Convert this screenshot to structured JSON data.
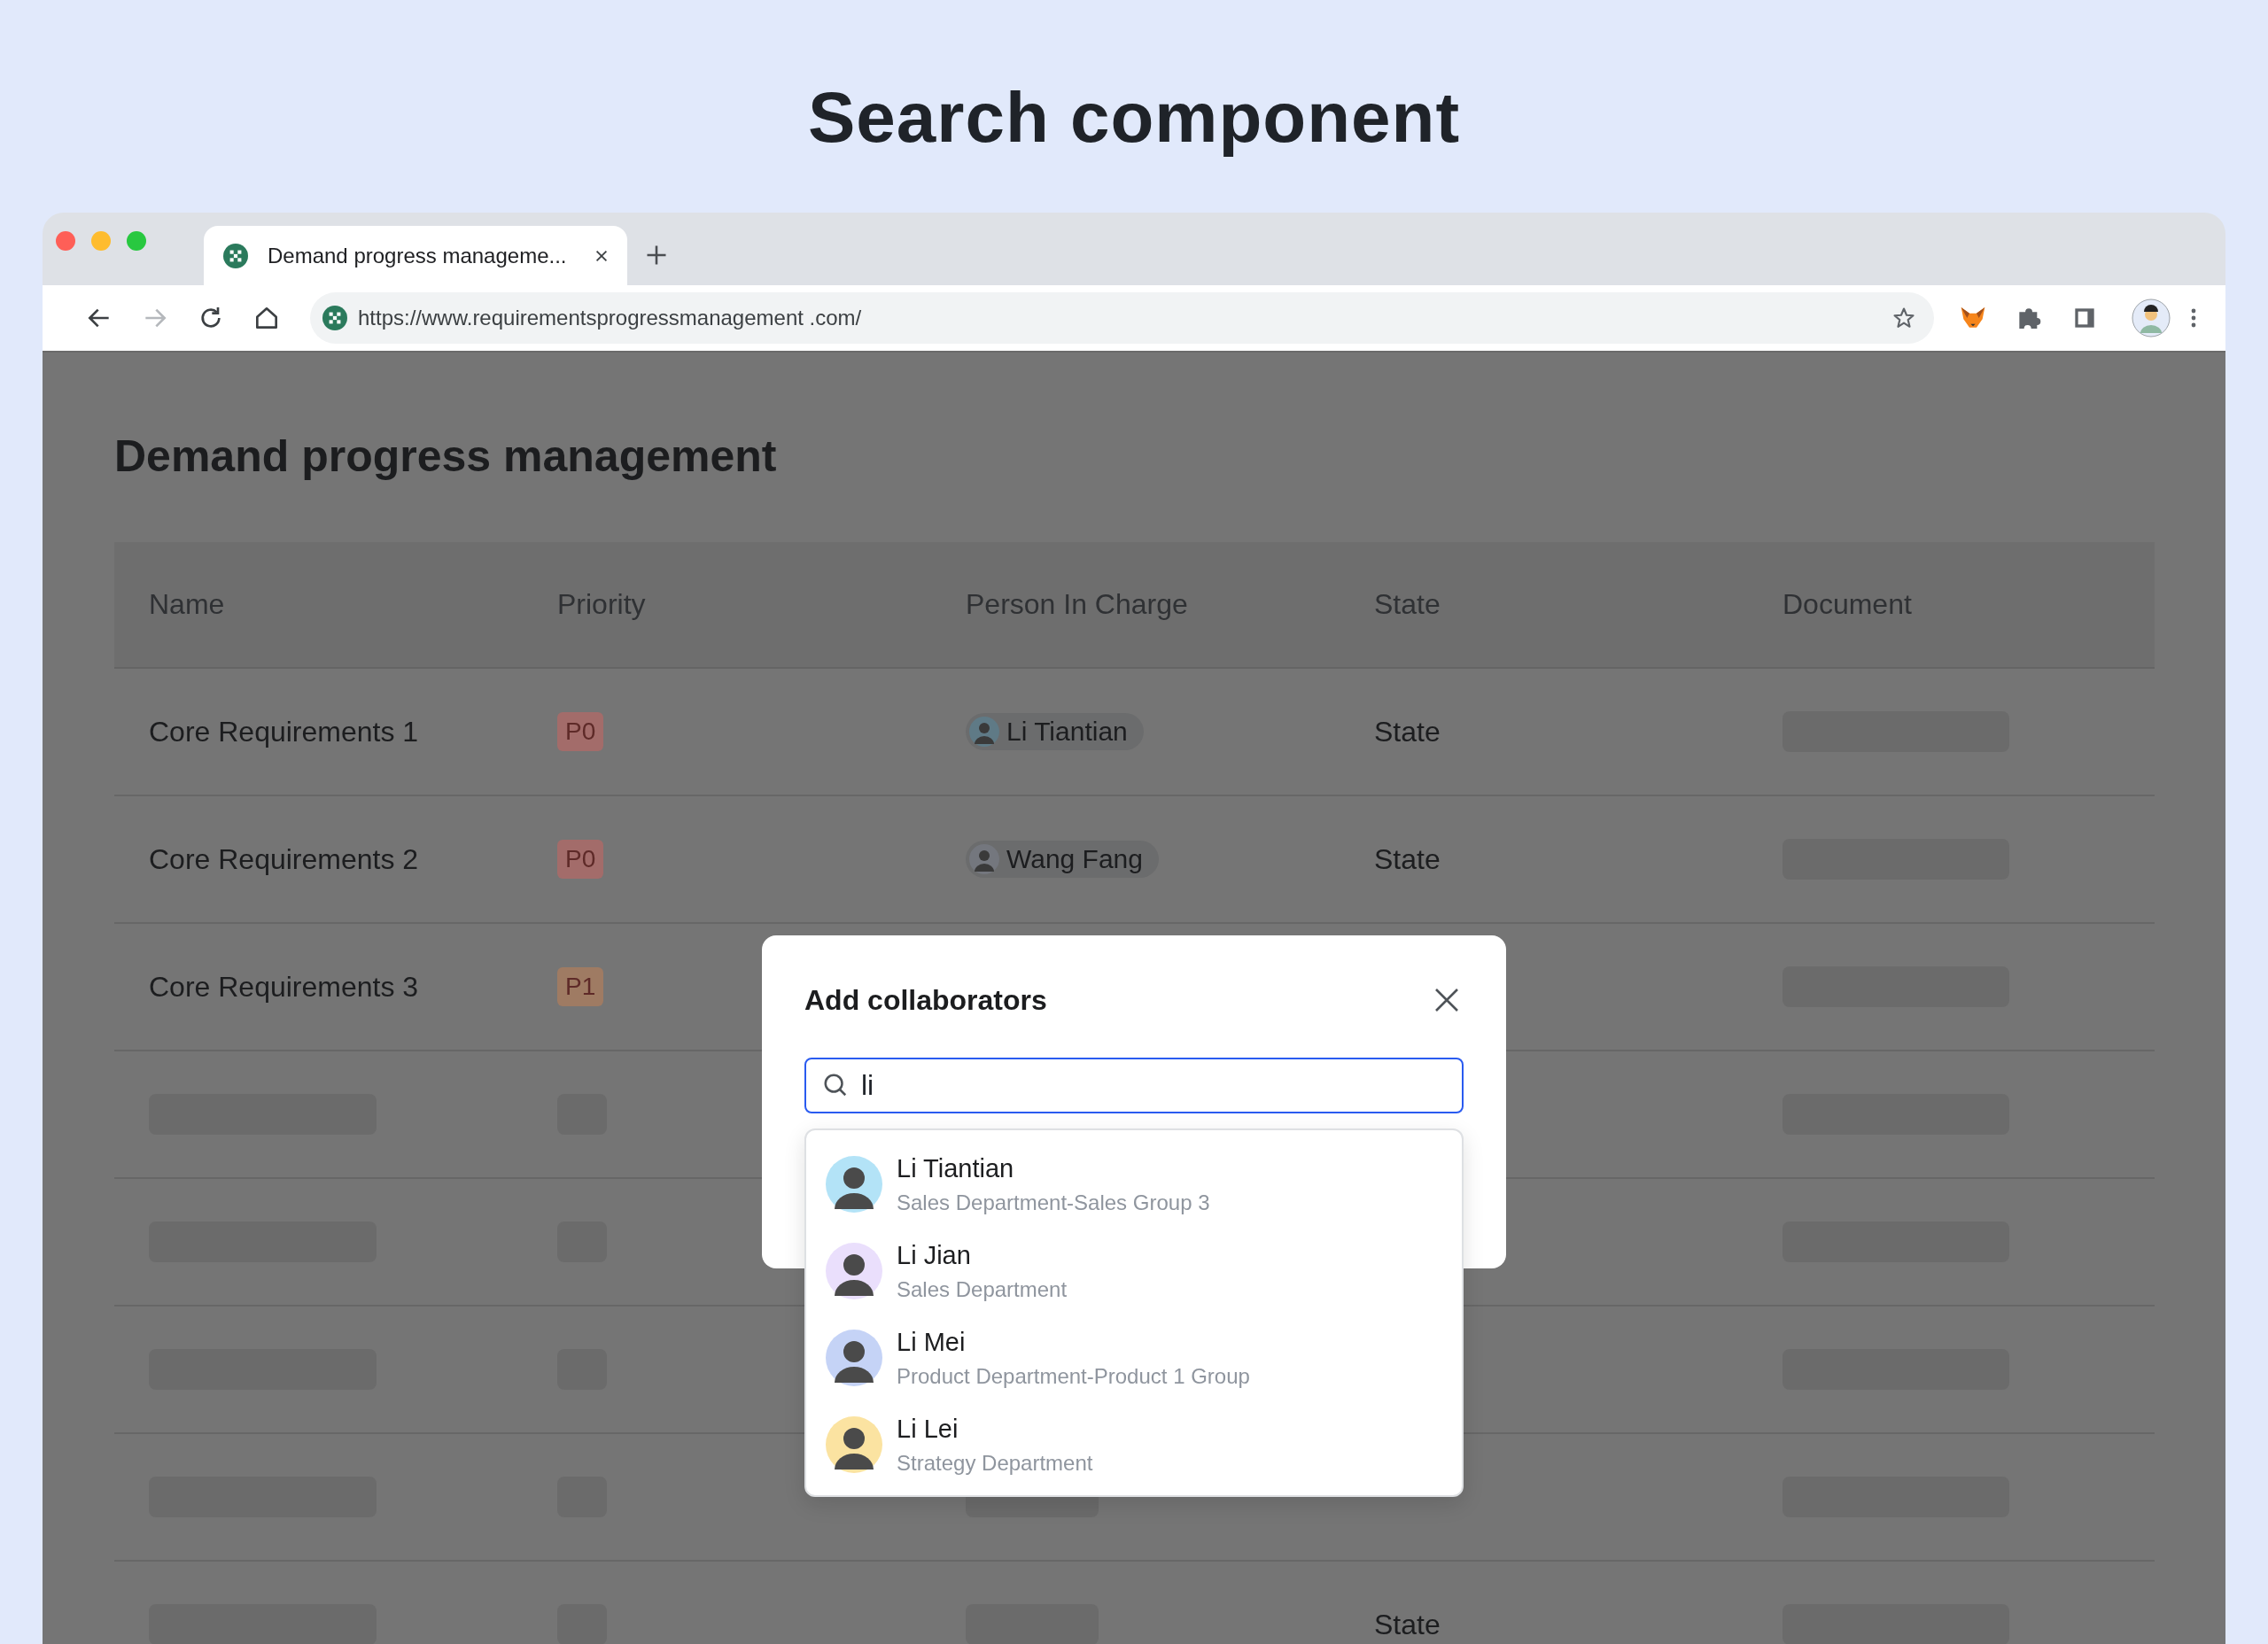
{
  "page_title": "Search component",
  "browser": {
    "tab": {
      "title": "Demand progress manageme..."
    },
    "url": "https://www.requirementsprogressmanagement .com/"
  },
  "app": {
    "heading": "Demand progress management",
    "table": {
      "columns": [
        "Name",
        "Priority",
        "Person In Charge",
        "State",
        "Document"
      ],
      "rows": [
        {
          "kind": "filled",
          "name": "Core Requirements 1",
          "priority": {
            "label": "P0",
            "color": "#a36c6a"
          },
          "person": {
            "name": "Li Tiantian",
            "color": "#5f7a86"
          },
          "state": "State"
        },
        {
          "kind": "filled",
          "name": "Core Requirements 2",
          "priority": {
            "label": "P0",
            "color": "#a36c6a"
          },
          "person": {
            "name": "Wang Fang",
            "color": "#74777e"
          },
          "state": "State"
        },
        {
          "kind": "filled",
          "name": "Core Requirements 3",
          "priority": {
            "label": "P1",
            "color": "#9f7b63"
          }
        },
        {
          "kind": "placeholder"
        },
        {
          "kind": "placeholder"
        },
        {
          "kind": "placeholder"
        },
        {
          "kind": "placeholder",
          "person_placeholder": true
        },
        {
          "kind": "placeholder",
          "person_placeholder": true,
          "state": "State"
        }
      ]
    }
  },
  "dialog": {
    "title": "Add collaborators",
    "search": {
      "value": "li"
    },
    "results": [
      {
        "name": "Li Tiantian",
        "department": "Sales Department-Sales Group 3",
        "color": "#b3e3f7"
      },
      {
        "name": "Li Jian",
        "department": "Sales Department",
        "color": "#eadffc"
      },
      {
        "name": "Li Mei",
        "department": "Product Department-Product 1 Group",
        "color": "#c5d3f6"
      },
      {
        "name": "Li Lei",
        "department": "Strategy Department",
        "color": "#fbe3a1"
      }
    ]
  }
}
